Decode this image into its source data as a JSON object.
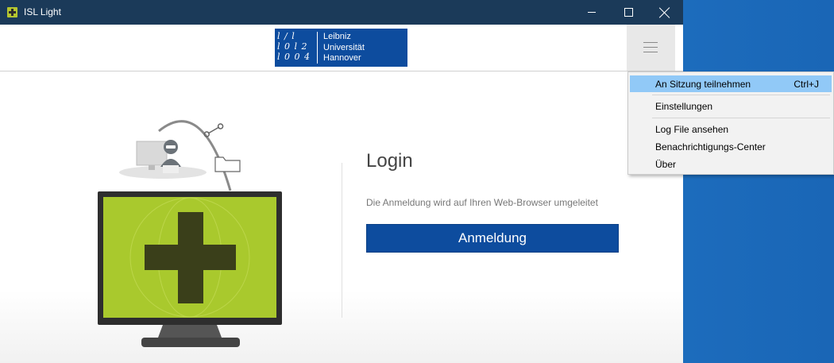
{
  "window": {
    "title": "ISL Light",
    "controls": {
      "minimize": "minimize",
      "maximize": "maximize",
      "close": "close"
    }
  },
  "header": {
    "logo": {
      "numerals": [
        "l / l",
        "l 0 l 2",
        "l 0 0 4"
      ],
      "lines": [
        "Leibniz",
        "Universität",
        "Hannover"
      ]
    }
  },
  "login": {
    "title": "Login",
    "subtitle": "Die Anmeldung wird auf Ihren Web-Browser umgeleitet",
    "button": "Anmeldung"
  },
  "menu": {
    "items": [
      {
        "label": "An Sitzung teilnehmen",
        "shortcut": "Ctrl+J",
        "highlighted": true
      },
      {
        "label": "Einstellungen"
      },
      {
        "label": "Log File ansehen"
      },
      {
        "label": "Benachrichtigungs-Center"
      },
      {
        "label": "Über"
      }
    ]
  },
  "colors": {
    "titlebar": "#1b3a59",
    "brand_blue": "#0d4c9e",
    "accent_green": "#b5c630",
    "menu_highlight": "#91c9f7"
  }
}
